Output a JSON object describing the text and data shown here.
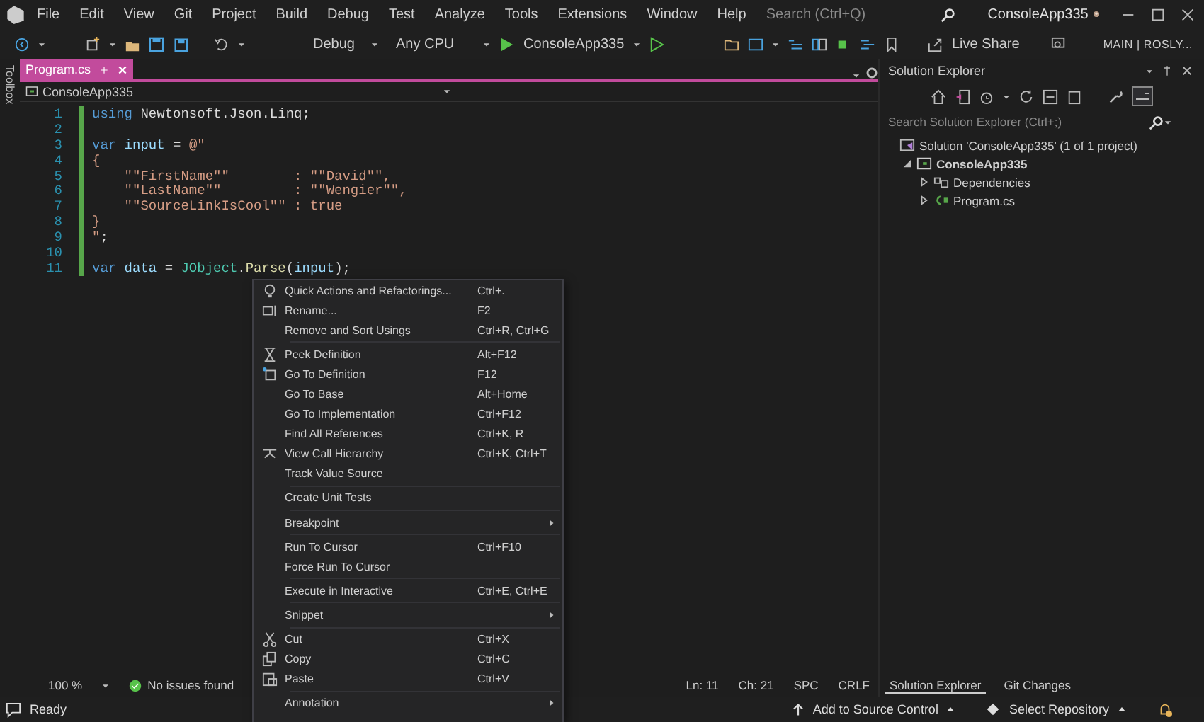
{
  "title_bar": {
    "menu": [
      "File",
      "Edit",
      "View",
      "Git",
      "Project",
      "Build",
      "Debug",
      "Test",
      "Analyze",
      "Tools",
      "Extensions",
      "Window",
      "Help"
    ],
    "search": {
      "placeholder": "Search (Ctrl+Q)"
    },
    "title": "ConsoleApp335"
  },
  "toolbar": {
    "configuration": "Debug",
    "platform": "Any CPU",
    "start_target": "ConsoleApp335",
    "live_share": "Live Share",
    "branch": "MAIN | ROSLY..."
  },
  "toolbox_label": "Toolbox",
  "document_tabs": [
    {
      "label": "Program.cs",
      "selected": true
    }
  ],
  "navigation_bar": {
    "project": "ConsoleApp335"
  },
  "code_lines": [
    {
      "number": "1",
      "tokens": [
        {
          "kind": "keyword",
          "text": "using"
        },
        {
          "kind": "plain",
          "text": " Newtonsoft.Json.Linq;"
        }
      ]
    },
    {
      "number": "2"
    },
    {
      "number": "3",
      "tokens": [
        {
          "kind": "keyword",
          "text": "var"
        },
        {
          "kind": "ident",
          "text": " input"
        },
        {
          "kind": "plain",
          "text": " = "
        },
        {
          "kind": "string",
          "text": "@\""
        }
      ]
    },
    {
      "number": "4",
      "tokens": [
        {
          "kind": "string",
          "text": "{"
        }
      ]
    },
    {
      "number": "5",
      "tokens": [
        {
          "kind": "string",
          "text": "    \"\"FirstName\"\"        : \"\"David\"\","
        }
      ]
    },
    {
      "number": "6",
      "tokens": [
        {
          "kind": "string",
          "text": "    \"\"LastName\"\"         : \"\"Wengier\"\","
        }
      ]
    },
    {
      "number": "7",
      "tokens": [
        {
          "kind": "string",
          "text": "    \"\"SourceLinkIsCool\"\" : true"
        }
      ]
    },
    {
      "number": "8",
      "tokens": [
        {
          "kind": "string",
          "text": "}"
        }
      ]
    },
    {
      "number": "9",
      "tokens": [
        {
          "kind": "string",
          "text": "\""
        },
        {
          "kind": "plain",
          "text": ";"
        }
      ]
    },
    {
      "number": "10"
    },
    {
      "number": "11",
      "tokens": [
        {
          "kind": "keyword",
          "text": "var"
        },
        {
          "kind": "ident",
          "text": " data"
        },
        {
          "kind": "plain",
          "text": " = "
        },
        {
          "kind": "type",
          "text": "JObject"
        },
        {
          "kind": "plain",
          "text": "."
        },
        {
          "kind": "method",
          "text": "Parse"
        },
        {
          "kind": "plain",
          "text": "("
        },
        {
          "kind": "ident",
          "text": "input"
        },
        {
          "kind": "plain",
          "text": ");"
        }
      ]
    }
  ],
  "editor_status": {
    "zoom": "100 %",
    "issues": "No issues found",
    "line": "Ln: 11",
    "column": "Ch: 21",
    "whitespace": "SPC",
    "line_endings": "CRLF"
  },
  "context_menu": [
    [
      {
        "label": "Quick Actions and Refactorings...",
        "shortcut": "Ctrl+.",
        "kind": "bulb"
      },
      {
        "label": "Rename...",
        "shortcut": "F2",
        "kind": "rename"
      },
      {
        "label": "Remove and Sort Usings",
        "shortcut": "Ctrl+R, Ctrl+G"
      }
    ],
    [
      {
        "label": "Peek Definition",
        "shortcut": "Alt+F12",
        "kind": "peek"
      },
      {
        "label": "Go To Definition",
        "shortcut": "F12",
        "kind": "goto"
      },
      {
        "label": "Go To Base",
        "shortcut": "Alt+Home"
      },
      {
        "label": "Go To Implementation",
        "shortcut": "Ctrl+F12"
      },
      {
        "label": "Find All References",
        "shortcut": "Ctrl+K, R"
      },
      {
        "label": "View Call Hierarchy",
        "shortcut": "Ctrl+K, Ctrl+T",
        "kind": "hierarchy"
      },
      {
        "label": "Track Value Source"
      }
    ],
    [
      {
        "label": "Create Unit Tests"
      }
    ],
    [
      {
        "label": "Breakpoint",
        "submenu": true
      }
    ],
    [
      {
        "label": "Run To Cursor",
        "shortcut": "Ctrl+F10"
      },
      {
        "label": "Force Run To Cursor"
      }
    ],
    [
      {
        "label": "Execute in Interactive",
        "shortcut": "Ctrl+E, Ctrl+E"
      }
    ],
    [
      {
        "label": "Snippet",
        "submenu": true
      }
    ],
    [
      {
        "label": "Cut",
        "shortcut": "Ctrl+X",
        "kind": "cut"
      },
      {
        "label": "Copy",
        "shortcut": "Ctrl+C",
        "kind": "copy"
      },
      {
        "label": "Paste",
        "shortcut": "Ctrl+V",
        "kind": "paste"
      }
    ],
    [
      {
        "label": "Annotation",
        "submenu": true
      }
    ]
  ],
  "solution_explorer": {
    "title": "Solution Explorer",
    "search": {
      "placeholder": "Search Solution Explorer (Ctrl+;)"
    },
    "tree": [
      {
        "kind": "solution",
        "label": "Solution 'ConsoleApp335' (1 of 1 project)",
        "children": [
          {
            "kind": "project",
            "label": "ConsoleApp335",
            "expanded": true,
            "children": [
              {
                "kind": "dependencies",
                "label": "Dependencies",
                "expanded": false
              },
              {
                "kind": "file",
                "label": "Program.cs",
                "expanded": false
              }
            ]
          }
        ]
      }
    ],
    "bottom_tabs": [
      {
        "label": "Solution Explorer",
        "selected": true
      },
      {
        "label": "Git Changes",
        "selected": false
      }
    ]
  },
  "status_bar": {
    "state": "Ready",
    "source_control": "Add to Source Control",
    "repository": "Select Repository"
  }
}
